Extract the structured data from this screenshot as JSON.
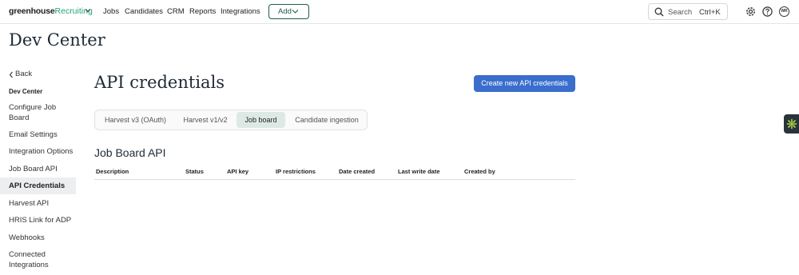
{
  "brand": {
    "name": "greenhouse",
    "product": "Recruiting"
  },
  "nav": {
    "items": [
      {
        "label": "Jobs",
        "name": "nav-jobs"
      },
      {
        "label": "Candidates",
        "name": "nav-candidates"
      },
      {
        "label": "CRM",
        "name": "nav-crm"
      },
      {
        "label": "Reports",
        "name": "nav-reports"
      },
      {
        "label": "Integrations",
        "name": "nav-integrations"
      }
    ],
    "add_label": "Add",
    "search_placeholder": "Search",
    "search_shortcut": "Ctrl+K",
    "avatar_initials": "WR"
  },
  "page": {
    "title": "Dev Center"
  },
  "sidebar": {
    "back_label": "Back",
    "heading": "Dev Center",
    "items": [
      {
        "label": "Configure Job Board",
        "active": false
      },
      {
        "label": "Email Settings",
        "active": false
      },
      {
        "label": "Integration Options",
        "active": false
      },
      {
        "label": "Job Board API",
        "active": false
      },
      {
        "label": "API Credentials",
        "active": true
      },
      {
        "label": "Harvest API",
        "active": false
      },
      {
        "label": "HRIS Link for ADP",
        "active": false
      },
      {
        "label": "Webhooks",
        "active": false
      },
      {
        "label": "Connected Integrations",
        "active": false
      }
    ]
  },
  "main": {
    "title": "API credentials",
    "create_button": "Create new API credentials",
    "tabs": [
      {
        "label": "Harvest v3 (OAuth)",
        "active": false
      },
      {
        "label": "Harvest v1/v2",
        "active": false
      },
      {
        "label": "Job board",
        "active": true
      },
      {
        "label": "Candidate ingestion",
        "active": false
      }
    ],
    "section_title": "Job Board API",
    "columns": [
      "Description",
      "Status",
      "API key",
      "IP restrictions",
      "Date created",
      "Last write date",
      "Created by"
    ]
  },
  "colors": {
    "brand_green": "#24a47f",
    "primary_button": "#3a6ecd",
    "active_tab_bg": "#dde9e4",
    "sidebar_active_bg": "#eceeef"
  },
  "icons": [
    "chevron-down-icon",
    "search-icon",
    "gear-icon",
    "help-icon",
    "chevron-left-icon",
    "widget-icon"
  ]
}
